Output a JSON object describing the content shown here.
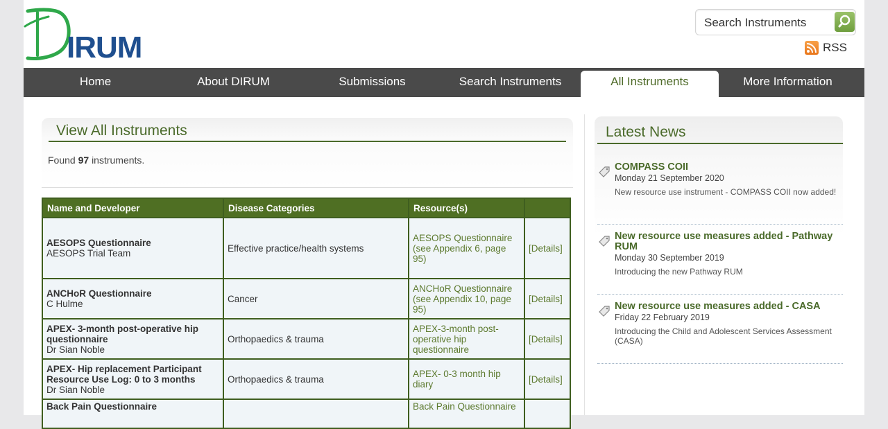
{
  "header": {
    "logo_text": "DIRUM",
    "search_placeholder": "Search Instruments",
    "rss_label": "RSS"
  },
  "nav": [
    {
      "label": "Home"
    },
    {
      "label": "About DIRUM"
    },
    {
      "label": "Submissions"
    },
    {
      "label": "Search Instruments"
    },
    {
      "label": "All Instruments",
      "active": true
    },
    {
      "label": "More Information"
    }
  ],
  "main": {
    "title": "View All Instruments",
    "found_prefix": "Found",
    "found_count": "97",
    "found_suffix": "instruments.",
    "table": {
      "headers": [
        "Name and Developer",
        "Disease Categories",
        "Resource(s)",
        ""
      ],
      "rows": [
        {
          "name": "AESOPS Questionnaire",
          "developer": "AESOPS Trial Team",
          "category": "Effective practice/health systems",
          "resource": "AESOPS Questionnaire (see Appendix 6, page 95)",
          "details": "[Details]"
        },
        {
          "name": "ANCHoR Questionnaire",
          "developer": "C Hulme",
          "category": "Cancer",
          "resource": "ANCHoR Questionnaire (see Appendix 10, page 95)",
          "details": "[Details]"
        },
        {
          "name": "APEX- 3-month post-operative hip questionnaire",
          "developer": "Dr Sian Noble",
          "category": "Orthopaedics & trauma",
          "resource": "APEX-3-month post-operative hip questionnaire",
          "details": "[Details]"
        },
        {
          "name": "APEX- Hip replacement Participant Resource Use Log: 0 to 3 months",
          "developer": "Dr Sian Noble",
          "category": "Orthopaedics & trauma",
          "resource": "APEX- 0-3 month hip diary",
          "details": "[Details]"
        },
        {
          "name": "Back Pain Questionnaire",
          "developer": "",
          "category": "",
          "resource": "Back Pain Questionnaire",
          "details": ""
        }
      ]
    }
  },
  "news": {
    "title": "Latest News",
    "items": [
      {
        "headline": "COMPASS COII",
        "date": "Monday 21 September 2020",
        "desc": "New resource use instrument - COMPASS COII now added!"
      },
      {
        "headline": "New resource use measures added - Pathway RUM",
        "date": "Monday 30 September 2019",
        "desc": "Introducing the new Pathway RUM"
      },
      {
        "headline": "New resource use measures added - CASA",
        "date": "Friday 22 February 2019",
        "desc": "Introducing the Child and Adolescent Services Assessment (CASA)"
      }
    ]
  },
  "colors": {
    "brand_green": "#4a6a2a",
    "logo_blue": "#1f4f8f",
    "nav_bg": "#4a4a4a",
    "table_header": "#4f6f23",
    "row_bg": "#f0f5f8"
  }
}
